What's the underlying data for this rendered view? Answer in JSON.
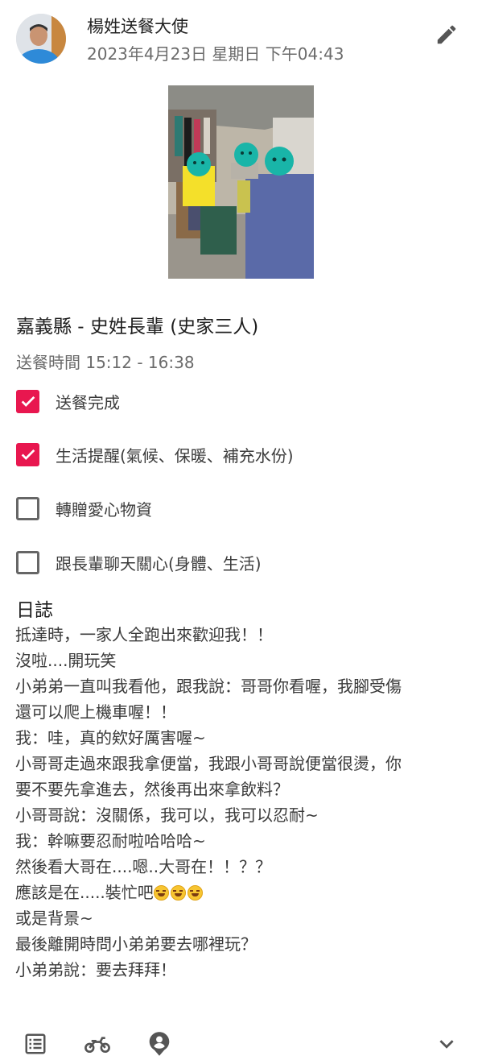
{
  "post": {
    "author": "楊姓送餐大使",
    "datetime": "2023年4月23日 星期日 下午04:43",
    "place": "嘉義縣 - 史姓長輩 (史家三人)",
    "time": "送餐時間 15:12 - 16:38"
  },
  "checklist": [
    {
      "label": "送餐完成",
      "checked": true
    },
    {
      "label": "生活提醒(氣候、保暖、補充水份)",
      "checked": true
    },
    {
      "label": "轉贈愛心物資",
      "checked": false
    },
    {
      "label": "跟長輩聊天關心(身體、生活)",
      "checked": false
    }
  ],
  "log": {
    "title": "日誌",
    "lines": [
      "抵達時，一家人全跑出來歡迎我！！",
      "沒啦....開玩笑",
      "小弟弟一直叫我看他，跟我說：哥哥你看喔，我腳受傷",
      "還可以爬上機車喔！！",
      "我：哇，真的欸好厲害喔~",
      "小哥哥走過來跟我拿便當，我跟小哥哥說便當很燙，你",
      "要不要先拿進去，然後再出來拿飲料？",
      "小哥哥說：沒關係，我可以，我可以忍耐~",
      "我：幹嘛要忍耐啦哈哈哈~",
      "然後看大哥在....嗯..大哥在！！？？",
      "應該是在.....裝忙吧",
      "或是背景~",
      "最後離開時問小弟弟要去哪裡玩？",
      "小弟弟說：要去拜拜！"
    ],
    "emoji_after_line": 10,
    "emoji_count": 3,
    "emoji_name": "rolling-on-floor-laughing"
  },
  "icons": {
    "edit": "pencil-icon",
    "list": "list-icon",
    "scooter": "scooter-icon",
    "profile": "person-pin-icon",
    "expand": "chevron-down-icon"
  },
  "colors": {
    "accent": "#e8174f",
    "muted_text": "#6b6b6b",
    "icon": "#555555"
  }
}
